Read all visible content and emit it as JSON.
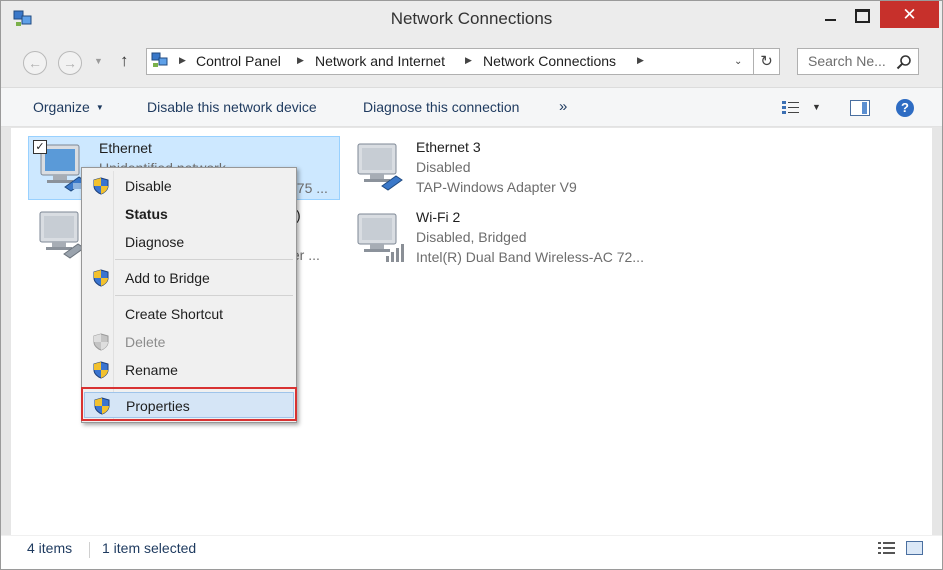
{
  "window": {
    "title": "Network Connections",
    "close_glyph": "✕",
    "icon": "network-connections-icon"
  },
  "address_bar": {
    "back_glyph": "←",
    "forward_glyph": "→",
    "up_glyph": "↑",
    "breadcrumbs": [
      "Control Panel",
      "Network and Internet",
      "Network Connections"
    ],
    "refresh_glyph": "↻",
    "search_placeholder": "Search Ne..."
  },
  "toolbar": {
    "organize": "Organize",
    "disable_device": "Disable this network device",
    "diagnose": "Diagnose this connection",
    "more": "»",
    "help_glyph": "?"
  },
  "connections": [
    {
      "name": "Ethernet",
      "status": "Unidentified network",
      "adapter": "175 ...",
      "selected": true,
      "checked": true,
      "type": "ethernet"
    },
    {
      "name": ")",
      "status": "",
      "adapter": "ter ...",
      "selected": false,
      "type": "ethernet"
    },
    {
      "name": "Ethernet 3",
      "status": "Disabled",
      "adapter": "TAP-Windows Adapter V9",
      "selected": false,
      "type": "ethernet"
    },
    {
      "name": "Wi-Fi 2",
      "status": "Disabled, Bridged",
      "adapter": "Intel(R) Dual Band Wireless-AC 72...",
      "selected": false,
      "type": "wifi"
    }
  ],
  "context_menu": {
    "items": [
      {
        "label": "Disable",
        "shield": true
      },
      {
        "label": "Status",
        "bold": true
      },
      {
        "label": "Diagnose"
      },
      {
        "label": "Add to Bridge",
        "shield": true
      },
      {
        "label": "Create Shortcut"
      },
      {
        "label": "Delete",
        "shield": true,
        "disabled": true
      },
      {
        "label": "Rename",
        "shield": true
      },
      {
        "label": "Properties",
        "shield": true,
        "highlighted": true
      }
    ]
  },
  "status_bar": {
    "items_count": "4 items",
    "selected_count": "1 item selected"
  },
  "colors": {
    "selection": "#cde8ff",
    "close_button": "#c7302b",
    "highlight_outline": "#d83232"
  }
}
